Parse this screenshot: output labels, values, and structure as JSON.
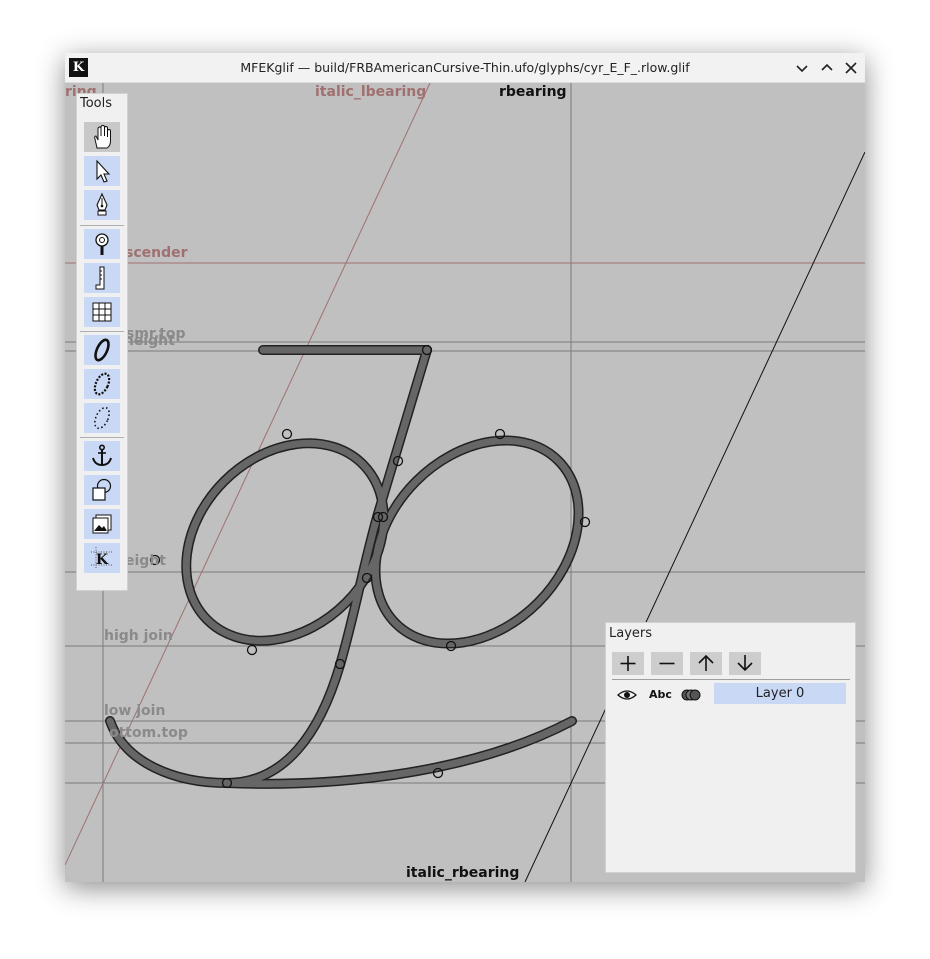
{
  "window": {
    "app_icon_letter": "K",
    "title": "MFEKglif — build/FRBAmericanCursive-Thin.ufo/glyphs/cyr_E_F_.rlow.glif",
    "controls": [
      "minimize-icon",
      "maximize-icon",
      "close-icon"
    ]
  },
  "guides": {
    "italic_lbearing": "italic_lbearing",
    "rbearing": "rbearing",
    "italic_rbearing": "italic_rbearing",
    "lbearing_partial": "ring",
    "ascender": "scender",
    "smr_top": "smr.top",
    "x_height": "x-height",
    "height_partial": "eight",
    "high_join": "high join",
    "low_join": "low join",
    "bottom_top": "ottom.top"
  },
  "tools": {
    "title": "Tools",
    "items": [
      {
        "icon": "hand-icon",
        "active": true
      },
      {
        "icon": "pointer-arrow-icon"
      },
      {
        "icon": "pen-nib-icon"
      },
      {
        "icon": "zoom-icon"
      },
      {
        "icon": "measure-ruler-icon"
      },
      {
        "icon": "grid-icon"
      },
      {
        "icon": "variable-width-stroke-icon"
      },
      {
        "icon": "pattern-along-path-icon"
      },
      {
        "icon": "dash-along-path-icon"
      },
      {
        "icon": "anchor-icon"
      },
      {
        "icon": "shapes-icon"
      },
      {
        "icon": "image-icon"
      },
      {
        "icon": "guidelines-icon",
        "letter": "K"
      }
    ]
  },
  "layers": {
    "title": "Layers",
    "buttons": [
      "add-icon",
      "remove-icon",
      "move-up-icon",
      "move-down-icon"
    ],
    "rows": [
      {
        "visible_icon": "eye-icon",
        "preview_label": "Abc",
        "combine_icon": "combine-icon",
        "name": "Layer 0"
      }
    ]
  },
  "colors": {
    "canvas_bg": "#c0c0c0",
    "guide_gray": "#7a7a7a",
    "italic_guide": "#a07070",
    "label_red": "#a07070",
    "label_gray": "#8a8a8a",
    "stroke_fill": "#666666",
    "tool_button": "#c9d8f5",
    "active_tool": "#c8c8c8"
  }
}
